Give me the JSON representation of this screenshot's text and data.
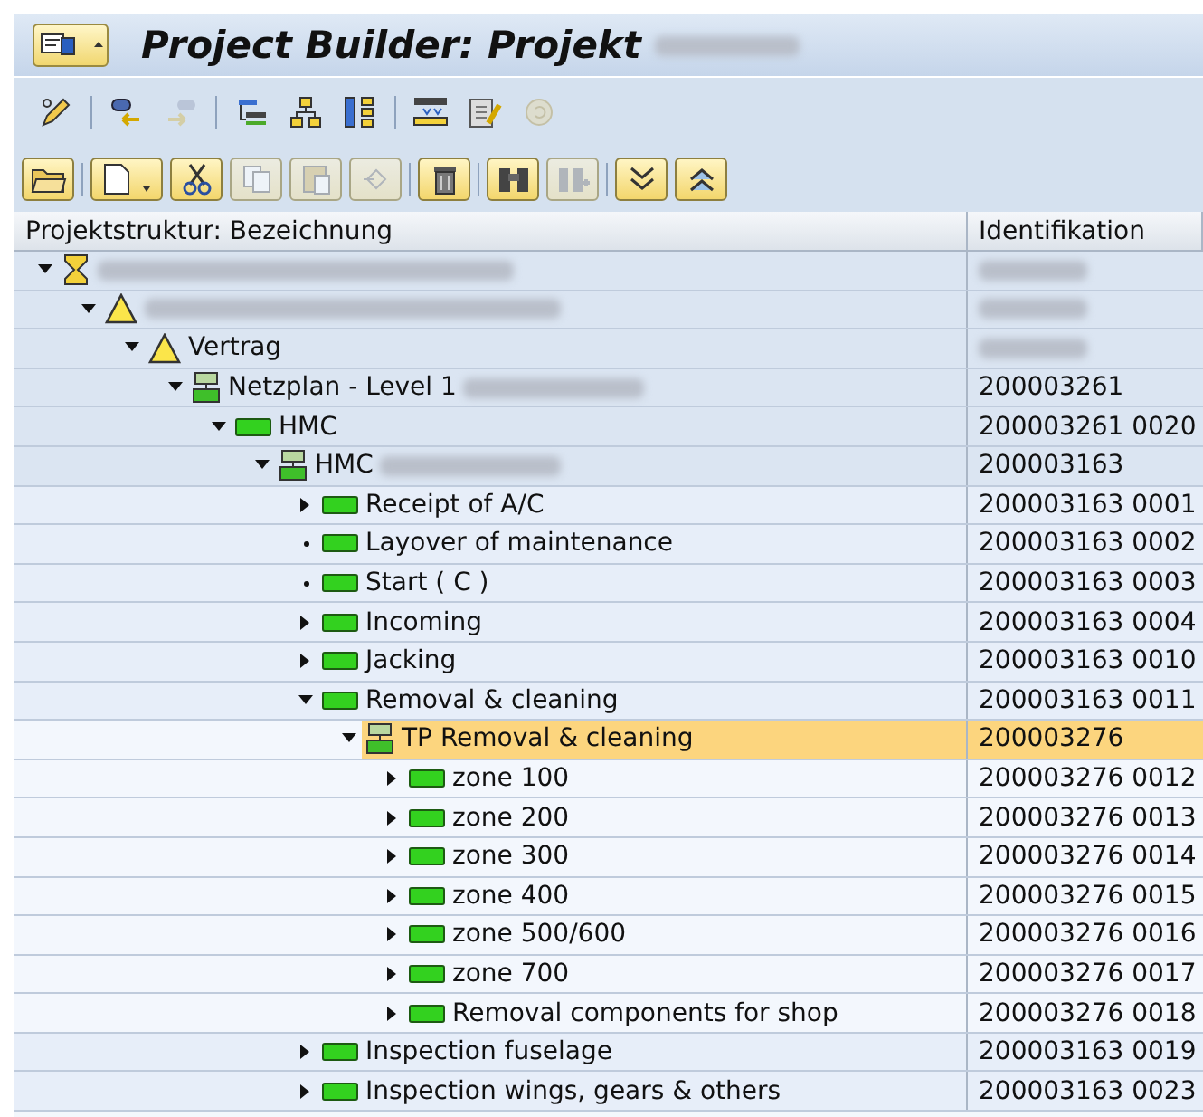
{
  "window": {
    "title": "Project Builder: Projekt",
    "title_blurred": true
  },
  "toolbar_1": [
    {
      "disabled": false
    },
    {
      "disabled": false
    },
    {
      "disabled": true
    },
    {
      "disabled": false
    },
    {
      "disabled": false
    },
    {
      "disabled": false
    },
    {
      "disabled": false
    },
    {
      "disabled": false
    },
    {
      "disabled": true
    }
  ],
  "toolbar_2": [
    {
      "disabled": false
    },
    {
      "disabled": false
    },
    {
      "disabled": false
    },
    {
      "disabled": true
    },
    {
      "disabled": true
    },
    {
      "disabled": true
    },
    {
      "disabled": false
    },
    {
      "disabled": false
    },
    {
      "disabled": true
    },
    {
      "disabled": false
    },
    {
      "disabled": false
    }
  ],
  "table": {
    "columns": [
      "Projektstruktur: Bezeichnung",
      "Identifikation"
    ],
    "rows": [
      {
        "kind": "project",
        "blur_name": true,
        "blur_id": true,
        "expandable": true,
        "expanded": true,
        "selected": false,
        "children": [
          {
            "kind": "wbs",
            "blur_name": true,
            "blur_id": true,
            "expandable": true,
            "expanded": true,
            "selected": false,
            "children": [
              {
                "kind": "wbs",
                "label": "Vertrag",
                "blur_name": false,
                "blur_id": true,
                "expandable": true,
                "expanded": true,
                "selected": false,
                "children": [
                  {
                    "kind": "network",
                    "label": "Netzplan - Level 1",
                    "blur_name": true,
                    "id": "200003261",
                    "blur_id": false,
                    "expandable": true,
                    "expanded": true,
                    "selected": false,
                    "children": [
                      {
                        "kind": "activity",
                        "label": "HMC",
                        "blur_name": false,
                        "id": "200003261 0020",
                        "blur_id": false,
                        "expandable": true,
                        "expanded": true,
                        "selected": false,
                        "children": [
                          {
                            "kind": "network",
                            "label": "HMC",
                            "blur_name": true,
                            "id": "200003163",
                            "blur_id": false,
                            "expandable": true,
                            "expanded": true,
                            "selected": false,
                            "children": [
                              {
                                "kind": "activity",
                                "label": "Receipt of A/C",
                                "blur_name": false,
                                "id": "200003163 0001",
                                "blur_id": false,
                                "expandable": true,
                                "expanded": false,
                                "selected": false
                              },
                              {
                                "kind": "activity",
                                "label": "Layover of maintenance",
                                "blur_name": false,
                                "id": "200003163 0002",
                                "blur_id": false,
                                "expandable": false,
                                "selected": false
                              },
                              {
                                "kind": "activity",
                                "label": "Start ( C )",
                                "blur_name": false,
                                "id": "200003163 0003",
                                "blur_id": false,
                                "expandable": false,
                                "selected": false
                              },
                              {
                                "kind": "activity",
                                "label": "Incoming",
                                "blur_name": false,
                                "id": "200003163 0004",
                                "blur_id": false,
                                "expandable": true,
                                "expanded": false,
                                "selected": false
                              },
                              {
                                "kind": "activity",
                                "label": "Jacking",
                                "blur_name": false,
                                "id": "200003163 0010",
                                "blur_id": false,
                                "expandable": true,
                                "expanded": false,
                                "selected": false
                              },
                              {
                                "kind": "activity",
                                "label": "Removal & cleaning",
                                "blur_name": false,
                                "id": "200003163 0011",
                                "blur_id": false,
                                "expandable": true,
                                "expanded": true,
                                "selected": false,
                                "children": [
                                  {
                                    "kind": "network",
                                    "label": "TP Removal & cleaning",
                                    "blur_name": false,
                                    "id": "200003276",
                                    "blur_id": false,
                                    "expandable": true,
                                    "expanded": true,
                                    "selected": true,
                                    "children": [
                                      {
                                        "kind": "activity",
                                        "label": "zone 100",
                                        "blur_name": false,
                                        "id": "200003276 0012",
                                        "blur_id": false,
                                        "expandable": true,
                                        "expanded": false,
                                        "selected": false
                                      },
                                      {
                                        "kind": "activity",
                                        "label": "zone 200",
                                        "blur_name": false,
                                        "id": "200003276 0013",
                                        "blur_id": false,
                                        "expandable": true,
                                        "expanded": false,
                                        "selected": false
                                      },
                                      {
                                        "kind": "activity",
                                        "label": "zone 300",
                                        "blur_name": false,
                                        "id": "200003276 0014",
                                        "blur_id": false,
                                        "expandable": true,
                                        "expanded": false,
                                        "selected": false
                                      },
                                      {
                                        "kind": "activity",
                                        "label": "zone 400",
                                        "blur_name": false,
                                        "id": "200003276 0015",
                                        "blur_id": false,
                                        "expandable": true,
                                        "expanded": false,
                                        "selected": false
                                      },
                                      {
                                        "kind": "activity",
                                        "label": "zone 500/600",
                                        "blur_name": false,
                                        "id": "200003276 0016",
                                        "blur_id": false,
                                        "expandable": true,
                                        "expanded": false,
                                        "selected": false
                                      },
                                      {
                                        "kind": "activity",
                                        "label": "zone 700",
                                        "blur_name": false,
                                        "id": "200003276 0017",
                                        "blur_id": false,
                                        "expandable": true,
                                        "expanded": false,
                                        "selected": false
                                      },
                                      {
                                        "kind": "activity",
                                        "label": "Removal components for shop",
                                        "blur_name": false,
                                        "id": "200003276 0018",
                                        "blur_id": false,
                                        "expandable": true,
                                        "expanded": false,
                                        "selected": false
                                      }
                                    ]
                                  }
                                ]
                              },
                              {
                                "kind": "activity",
                                "label": "Inspection fuselage",
                                "blur_name": false,
                                "id": "200003163 0019",
                                "blur_id": false,
                                "expandable": true,
                                "expanded": false,
                                "selected": false
                              },
                              {
                                "kind": "activity",
                                "label": "Inspection wings, gears & others",
                                "blur_name": false,
                                "id": "200003163 0023",
                                "blur_id": false,
                                "expandable": true,
                                "expanded": false,
                                "selected": false
                              }
                            ]
                          }
                        ]
                      }
                    ]
                  }
                ]
              }
            ]
          }
        ]
      }
    ]
  }
}
